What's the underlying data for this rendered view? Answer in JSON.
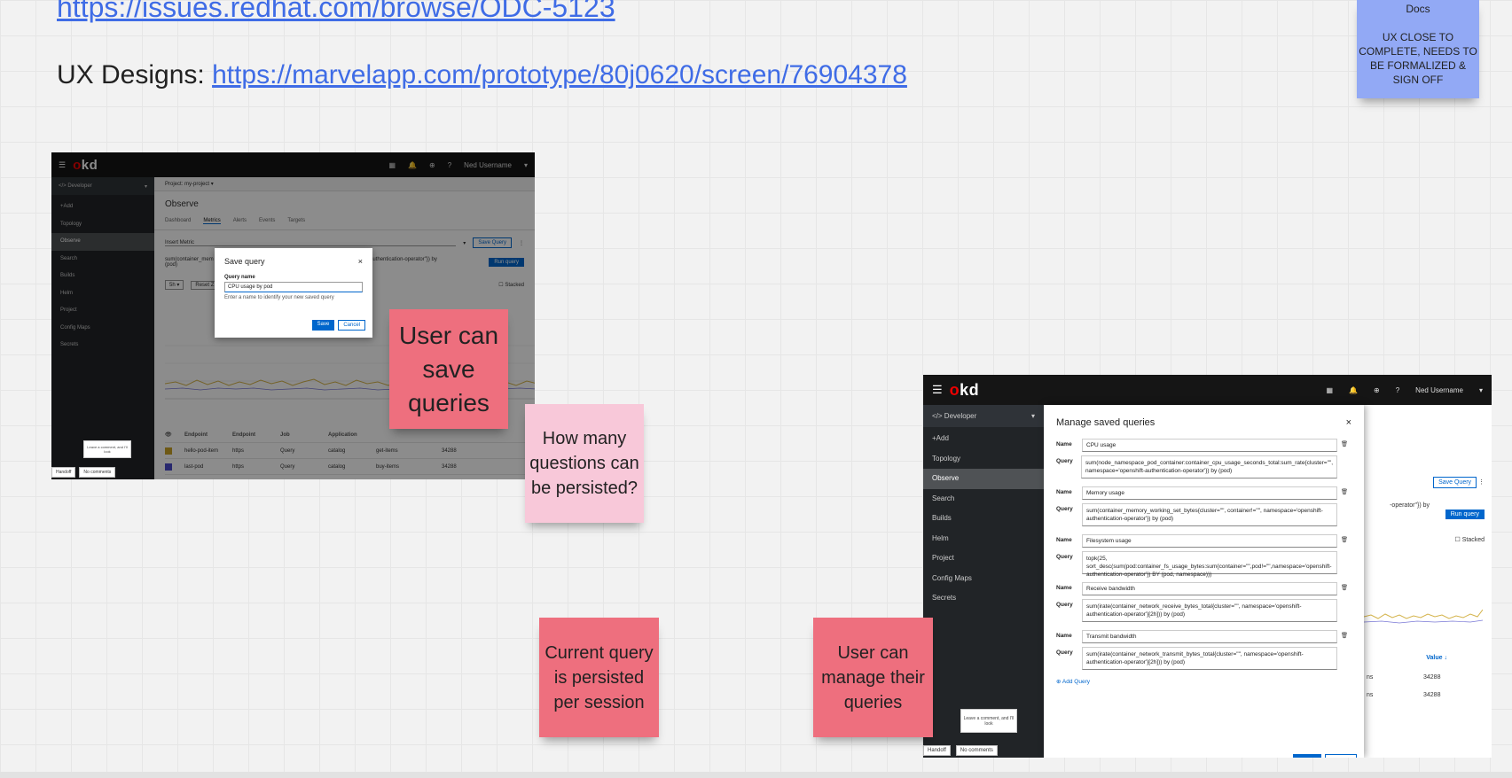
{
  "header": {
    "jira_link": "https://issues.redhat.com/browse/ODC-5123",
    "ux_label": "UX Designs: ",
    "ux_link": "https://marvelapp.com/prototype/80j0620/screen/76904378"
  },
  "stickies": {
    "docs_status": {
      "title": "Docs",
      "text": "UX CLOSE TO COMPLETE, NEEDS TO BE FORMALIZED & SIGN OFF",
      "color": "#92a9f5"
    },
    "save_queries": {
      "text": "User can save queries",
      "color": "#ee6f7e"
    },
    "how_many": {
      "text": "How many questions can be persisted?",
      "color": "#f8c8d9"
    },
    "current_query": {
      "text": "Current query is persisted per session",
      "color": "#ee6f7e"
    },
    "manage_queries": {
      "text": "User can manage their queries",
      "color": "#ee6f7e"
    }
  },
  "shot1": {
    "logo": "okd",
    "username": "Ned Username",
    "perspective": "Developer",
    "nav": [
      "+Add",
      "Topology",
      "Observe",
      "Search",
      "Builds",
      "Helm",
      "Project",
      "Config Maps",
      "Secrets"
    ],
    "project": "Project: my-project",
    "title": "Observe",
    "tabs": [
      "Dashboard",
      "Metrics",
      "Alerts",
      "Events",
      "Targets"
    ],
    "insert_metric": "Insert Metric",
    "save_query_btn": "Save Query",
    "run_query_btn": "Run query",
    "query_text_left": "sum(container_mem",
    "query_text_right": "openshift-authentication-operator\"}) by",
    "query_text_line2": "(pod)",
    "time_range": "5h",
    "reset_zoom": "Reset Z",
    "stacked": "Stacked",
    "table": {
      "headers": [
        "Endpoint",
        "Endpoint",
        "Job",
        "Application",
        "",
        ""
      ],
      "rows": [
        {
          "color": "#c9a227",
          "cells": [
            "hello-pod-item",
            "https",
            "Query",
            "catalog",
            "get-items",
            "34288"
          ]
        },
        {
          "color": "#4a49c9",
          "cells": [
            "last-pod",
            "https",
            "Query",
            "catalog",
            "buy-items",
            "34288"
          ]
        }
      ]
    },
    "modal": {
      "title": "Save query",
      "field_label": "Query name",
      "field_value": "CPU usage by pod",
      "helper": "Enter a name to identify your new saved query",
      "save": "Save",
      "cancel": "Cancel"
    },
    "feedback_bubble": "Leave a comment, and I'll look",
    "bottom": [
      "Handoff",
      "No comments"
    ]
  },
  "shot2": {
    "logo": "okd",
    "username": "Ned Username",
    "perspective": "Developer",
    "nav": [
      "+Add",
      "Topology",
      "Observe",
      "Search",
      "Builds",
      "Helm",
      "Project",
      "Config Maps",
      "Secrets"
    ],
    "bg": {
      "save_query_btn": "Save Query",
      "run_query_btn": "Run query",
      "query_fragment": "-operator\"}) by",
      "stacked": "Stacked",
      "value_header": "Value",
      "rows": [
        {
          "label": "ns",
          "value": "34288"
        },
        {
          "label": "ns",
          "value": "34288"
        }
      ]
    },
    "modal": {
      "title": "Manage saved queries",
      "name_label": "Name",
      "query_label": "Query",
      "queries": [
        {
          "name": "CPU usage",
          "query": "sum(node_namespace_pod_container:container_cpu_usage_seconds_total:sum_rate{cluster=\"\", namespace='openshift-authentication-operator'}) by (pod)"
        },
        {
          "name": "Memory usage",
          "query": "sum(container_memory_working_set_bytes{cluster=\"\", container!=\"\", namespace='openshift-authentication-operator'}) by (pod)"
        },
        {
          "name": "Filesystem usage",
          "query": "topk(25, sort_desc(sum(pod:container_fs_usage_bytes:sum{container=\"\",pod!=\"\",namespace='openshift-authentication-operator'}) BY (pod, namespace)))"
        },
        {
          "name": "Receive bandwidth",
          "query": "sum(irate(container_network_receive_bytes_total{cluster=\"\", namespace='openshift-authentication-operator'}[2h])) by (pod)"
        },
        {
          "name": "Transmit bandwidth",
          "query": "sum(irate(container_network_transmit_bytes_total{cluster=\"\", namespace='openshift-authentication-operator'}[2h])) by (pod)"
        }
      ],
      "add_query": "Add Query"
    },
    "feedback_bubble": "Leave a comment, and I'll look",
    "bottom": [
      "Handoff",
      "No comments"
    ]
  }
}
